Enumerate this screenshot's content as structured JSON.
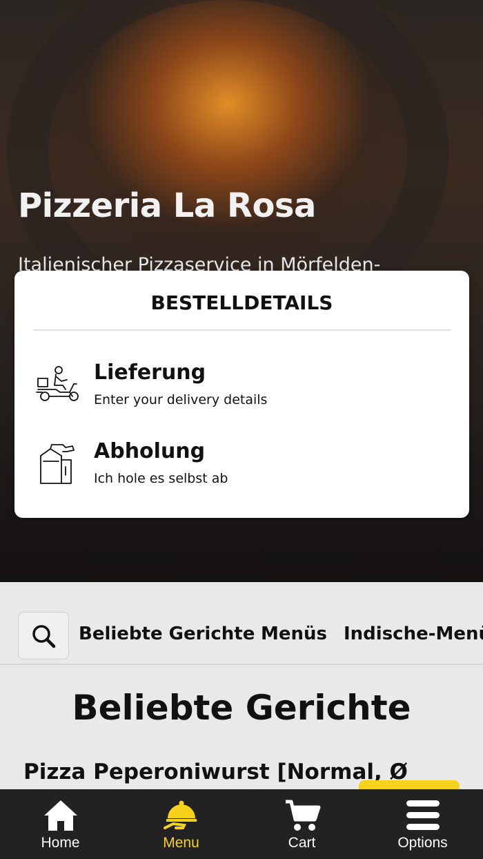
{
  "hero": {
    "title": "Pizzeria La Rosa",
    "subtitle": "Italienischer Pizzaservice in Mörfelden-"
  },
  "modal": {
    "title": "BESTELLDETAILS",
    "options": [
      {
        "label": "Lieferung",
        "description": "Enter your delivery details",
        "icon": "delivery-scooter-icon"
      },
      {
        "label": "Abholung",
        "description": "Ich hole es selbst ab",
        "icon": "takeaway-bag-icon"
      }
    ]
  },
  "categories": {
    "search_icon": "search-icon",
    "items": [
      "Beliebte Gerichte",
      "Menüs",
      "Indische-Menü"
    ]
  },
  "section": {
    "title": "Beliebte Gerichte",
    "first_item": "Pizza Peperoniwurst [Normal, Ø"
  },
  "tabbar": {
    "items": [
      {
        "label": "Home",
        "icon": "home-icon"
      },
      {
        "label": "Menu",
        "icon": "food-cloche-icon"
      },
      {
        "label": "Cart",
        "icon": "cart-icon"
      },
      {
        "label": "Options",
        "icon": "hamburger-menu-icon"
      }
    ],
    "active_color": "#f5d21b"
  }
}
